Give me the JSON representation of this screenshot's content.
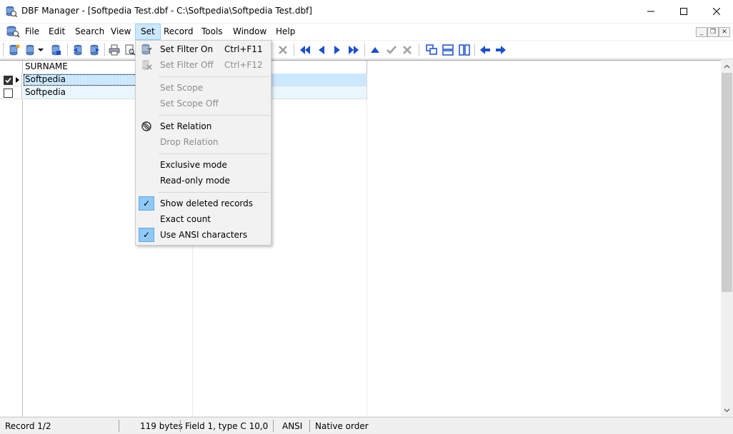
{
  "window": {
    "title": "DBF Manager - [Softpedia Test.dbf - C:\\Softpedia\\Softpedia Test.dbf]",
    "min_symbol": "─",
    "max_symbol": "☐",
    "close_symbol": "✕"
  },
  "menubar": {
    "items": [
      {
        "label": "File"
      },
      {
        "label": "Edit"
      },
      {
        "label": "Search"
      },
      {
        "label": "View"
      },
      {
        "label": "Set"
      },
      {
        "label": "Record"
      },
      {
        "label": "Tools"
      },
      {
        "label": "Window"
      },
      {
        "label": "Help"
      }
    ],
    "active": "Set",
    "mdi_min": "_",
    "mdi_restore": "❐",
    "mdi_close": "✕"
  },
  "toolbar": {
    "icons": [
      "new-table-icon",
      "open-table-icon",
      "dropdown-arrow-icon",
      "save-table-icon",
      "import-icon",
      "export-icon",
      "print-icon",
      "preview-icon",
      "filter-icon",
      "delete-icon",
      "first-record-icon",
      "prev-record-icon",
      "next-record-icon",
      "last-record-icon",
      "insert-record-icon",
      "post-record-icon",
      "cancel-record-icon",
      "cascade-icon",
      "tile-horizontal-icon",
      "tile-vertical-icon",
      "back-icon",
      "forward-icon"
    ],
    "accent": "#1a4fcf"
  },
  "grid": {
    "columns": [
      {
        "label": "SURNAME"
      },
      {
        "label": ""
      }
    ],
    "rows": [
      {
        "values": [
          "Softpedia",
          ""
        ],
        "marked": true
      },
      {
        "values": [
          "Softpedia",
          ""
        ],
        "marked": false
      }
    ],
    "selection_color": "#cce8ff",
    "alt_row_color": "#e9f6fd"
  },
  "set_menu": {
    "items": [
      {
        "label": "Set Filter On",
        "shortcut": "Ctrl+F11",
        "enabled": true,
        "icon": "filter-icon",
        "checked": false
      },
      {
        "label": "Set Filter Off",
        "shortcut": "Ctrl+F12",
        "enabled": false,
        "icon": "filter-off-icon",
        "checked": false
      },
      {
        "label": "Set Scope",
        "shortcut": "",
        "enabled": false,
        "checked": false
      },
      {
        "label": "Set Scope Off",
        "shortcut": "",
        "enabled": false,
        "checked": false
      },
      {
        "label": "Set Relation",
        "shortcut": "",
        "enabled": true,
        "icon": "relation-icon",
        "checked": false
      },
      {
        "label": "Drop Relation",
        "shortcut": "",
        "enabled": false,
        "checked": false
      },
      {
        "label": "Exclusive mode",
        "shortcut": "",
        "enabled": true,
        "checked": false
      },
      {
        "label": "Read-only mode",
        "shortcut": "",
        "enabled": true,
        "checked": false
      },
      {
        "label": "Show deleted records",
        "shortcut": "",
        "enabled": true,
        "checked": true
      },
      {
        "label": "Exact count",
        "shortcut": "",
        "enabled": true,
        "checked": false
      },
      {
        "label": "Use ANSI characters",
        "shortcut": "",
        "enabled": true,
        "checked": true
      }
    ],
    "check_symbol": "✓"
  },
  "status": {
    "record": "Record 1/2",
    "size": "119 bytes",
    "field": "Field 1, type C 10,0",
    "charset": "ANSI",
    "order": "Native order"
  }
}
